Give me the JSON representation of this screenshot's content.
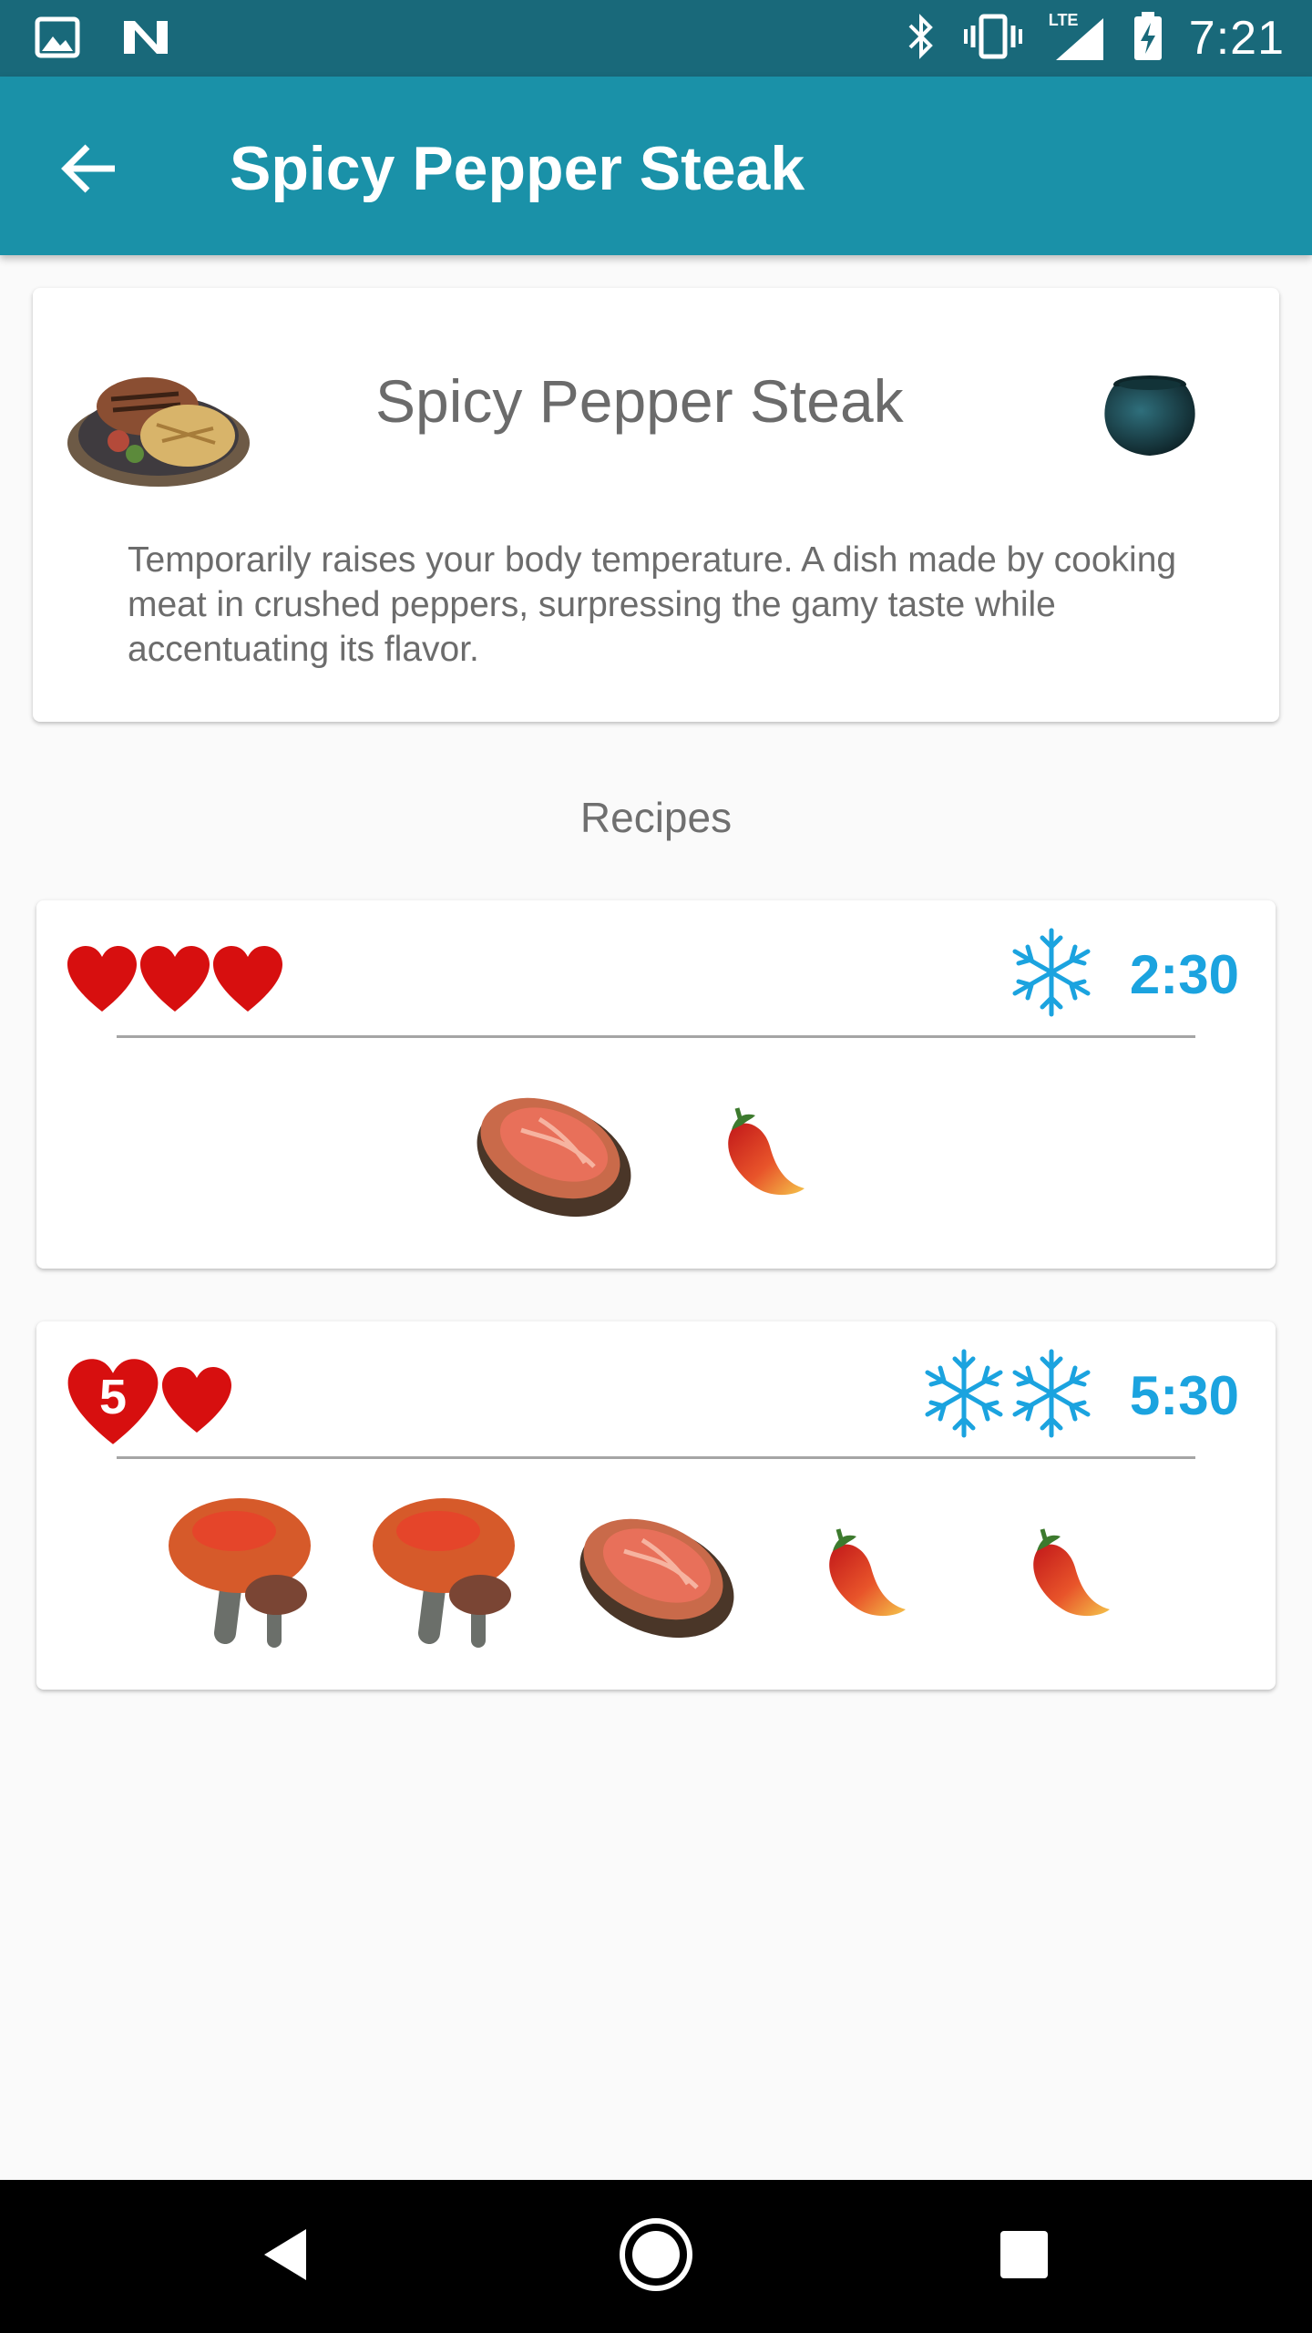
{
  "status_bar": {
    "time": "7:21",
    "network_label": "LTE",
    "icons": [
      "image-icon",
      "n-logo-icon",
      "bluetooth-icon",
      "vibrate-icon",
      "signal-icon",
      "battery-charging-icon"
    ]
  },
  "app_bar": {
    "title": "Spicy Pepper Steak",
    "back_icon": "arrow-back-icon"
  },
  "dish": {
    "name": "Spicy Pepper Steak",
    "description": "Temporarily raises your body temperature. A dish made by cooking meat in crushed peppers, surpressing the gamy taste while accentuating its flavor.",
    "image_icon": "steak-plate-icon",
    "cook_method_icon": "cooking-pot-icon"
  },
  "recipes_label": "Recipes",
  "recipes": [
    {
      "hearts_count": 3,
      "heart_badge": "",
      "effect_icon": "snowflake-icon",
      "effect_level": 1,
      "duration": "2:30",
      "ingredients": [
        "raw-meat-icon",
        "spicy-pepper-icon"
      ]
    },
    {
      "hearts_count": 2,
      "heart_badge": "5",
      "effect_icon": "snowflake-icon",
      "effect_level": 2,
      "duration": "5:30",
      "ingredients": [
        "mushroom-icon",
        "mushroom-icon",
        "raw-meat-icon",
        "spicy-pepper-icon",
        "spicy-pepper-icon"
      ]
    }
  ],
  "colors": {
    "status_bar": "#19697a",
    "app_bar": "#1a91a8",
    "heart": "#d70f0f",
    "accent_blue": "#1ba3df"
  },
  "nav_bar": {
    "icons": [
      "back-triangle-icon",
      "home-circle-icon",
      "recents-square-icon"
    ]
  }
}
